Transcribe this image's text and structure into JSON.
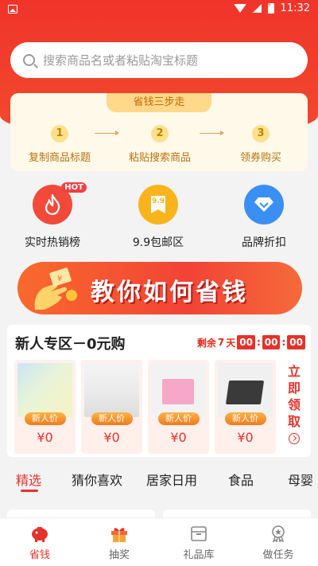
{
  "status": {
    "time": "11:32"
  },
  "search": {
    "placeholder": "搜索商品名或者粘贴淘宝标题"
  },
  "steps": {
    "title": "省钱三步走",
    "items": [
      {
        "num": "1",
        "label": "复制商品标题"
      },
      {
        "num": "2",
        "label": "粘贴搜索商品"
      },
      {
        "num": "3",
        "label": "领券购买"
      }
    ]
  },
  "categories": [
    {
      "label": "实时热销榜",
      "icon": "flame-icon",
      "badge": "HOT",
      "color": "#f24a3a"
    },
    {
      "label": "9.9包邮区",
      "icon": "coupon-9-9-icon",
      "badge_text": "9.9",
      "color": "#f9b41c"
    },
    {
      "label": "品牌折扣",
      "icon": "diamond-icon",
      "color": "#3a8ff2"
    }
  ],
  "banner": {
    "text": "教你如何省钱"
  },
  "newbie": {
    "title": "新人专区－0元购",
    "countdown_prefix": "剩余",
    "countdown_days": "7",
    "countdown_unit": "天",
    "hh": "00",
    "mm": "00",
    "ss": "00",
    "get_now": [
      "立",
      "即",
      "领",
      "取"
    ],
    "products": [
      {
        "badge": "新人价",
        "price": "¥0"
      },
      {
        "badge": "新人价",
        "price": "¥0"
      },
      {
        "badge": "新人价",
        "price": "¥0"
      },
      {
        "badge": "新人价",
        "price": "¥0"
      }
    ]
  },
  "tabs": [
    "精选",
    "猜你喜欢",
    "居家日用",
    "食品",
    "母婴"
  ],
  "bottom_nav": [
    {
      "label": "省钱",
      "icon": "piggy-bank-icon"
    },
    {
      "label": "抽奖",
      "icon": "gift-icon"
    },
    {
      "label": "礼品库",
      "icon": "box-icon"
    },
    {
      "label": "做任务",
      "icon": "medal-icon"
    }
  ],
  "colors": {
    "primary": "#e5322a",
    "hero": "#f0342a",
    "steps_bg": "#fff9ea"
  }
}
